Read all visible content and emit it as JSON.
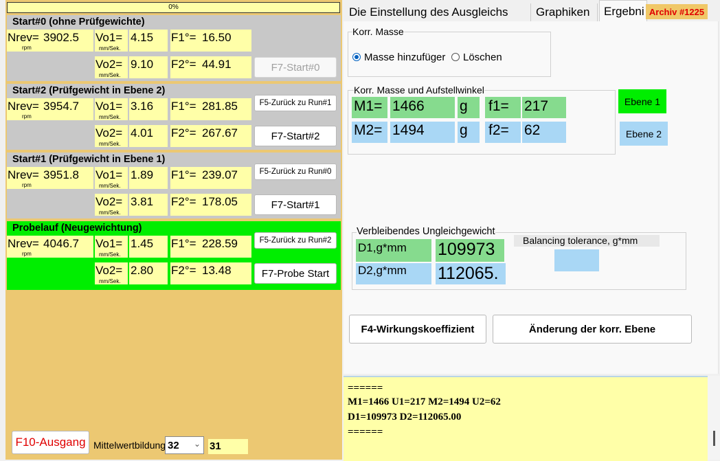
{
  "progress": {
    "label": "0%",
    "value": 0
  },
  "sections": {
    "start0": {
      "title": "Start#0 (ohne Prüfgewichte)",
      "nrev": "3902.5",
      "vo1": "4.15",
      "f1": "16.50",
      "vo2": "9.10",
      "f2": "44.91",
      "button": "F7-Start#0"
    },
    "start2": {
      "title": "Start#2 (Prüfgewicht in Ebene 2)",
      "nrev": "3954.7",
      "vo1": "3.16",
      "f1": "281.85",
      "vo2": "4.01",
      "f2": "267.67",
      "back_button": "F5-Zurück zu Run#1",
      "button": "F7-Start#2"
    },
    "start1": {
      "title": "Start#1 (Prüfgewicht in Ebene 1)",
      "nrev": "3951.8",
      "vo1": "1.89",
      "f1": "239.07",
      "vo2": "3.81",
      "f2": "178.05",
      "back_button": "F5-Zurück zu Run#0",
      "button": "F7-Start#1"
    },
    "probe": {
      "title": "Probelauf (Neugewichtung)",
      "nrev": "4046.7",
      "vo1": "1.45",
      "f1": "228.59",
      "vo2": "2.80",
      "f2": "13.48",
      "back_button": "F5-Zurück zu Run#2",
      "button": "F7-Probe Start"
    }
  },
  "labels": {
    "nrev": "Nrev=",
    "rpm": "rpm",
    "vo1": "Vo1=",
    "vo2": "Vo2=",
    "unit": "mm/Sek.",
    "f1": "F1°=",
    "f2": "F2°="
  },
  "bottom": {
    "exit_button": "F10-Ausgang",
    "avg_label": "Mittelwertbildung",
    "avg_select": "32",
    "avg_value": "31"
  },
  "tabs": [
    "Die Einstellung des Ausgleichs",
    "Graphiken",
    "Ergebni"
  ],
  "archive_badge": "Archiv #1225",
  "korr_masse": {
    "title": "Korr. Masse",
    "option_add": "Masse hinzufüger",
    "option_delete": "Löschen"
  },
  "korr_winkel": {
    "title": "Korr. Masse und Aufstellwinkel",
    "m1_label": "M1=",
    "m1_value": "1466",
    "unit": "g",
    "f1_label": "f1=",
    "f1_value": "217",
    "m2_label": "M2=",
    "m2_value": "1494",
    "f2_label": "f2=",
    "f2_value": "62",
    "ebene1": "Ebene 1",
    "ebene2": "Ebene 2"
  },
  "unbalance": {
    "title": "Verbleibendes Ungleichgewicht",
    "d1_label": "D1,g*mm",
    "d1_value": "109973",
    "d2_label": "D2,g*mm",
    "d2_value": "112065.",
    "tolerance_label": "Balancing tolerance, g*mm",
    "tolerance_value": ""
  },
  "buttons": {
    "f4": "F4-Wirkungskoeffizient",
    "change_plane": "Änderung der korr. Ebene"
  },
  "log": {
    "line1": "======",
    "line2": "M1=1466 U1=217 M2=1494 U2=62",
    "line3": "D1=109973 D2=112065.00",
    "line4": "======"
  },
  "colors": {
    "yellow_cell": "#ffffa8",
    "green_active": "#00ee00",
    "section_gray": "#c8c8c8",
    "background_tan": "#ecc872",
    "plane1_green": "#86db8e",
    "plane2_blue": "#a9d7f5",
    "archive_text": "#e00000"
  }
}
